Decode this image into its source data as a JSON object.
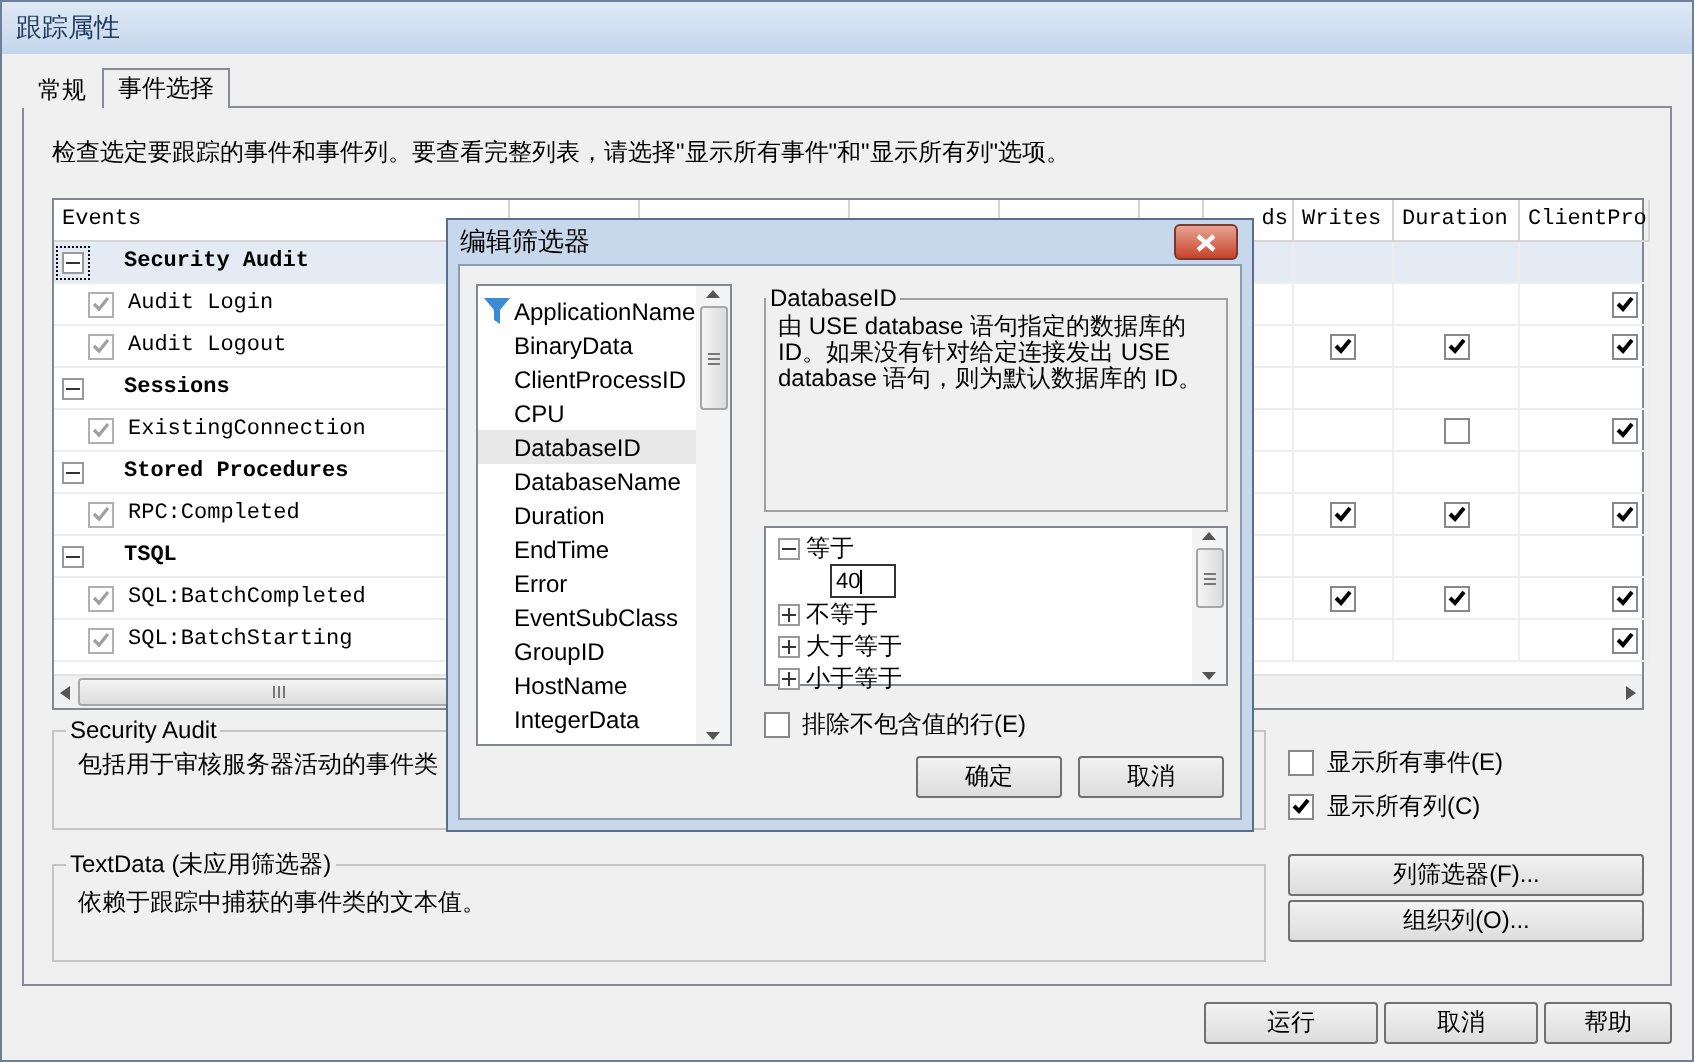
{
  "window": {
    "title": "跟踪属性"
  },
  "tabs": [
    {
      "label": "常规",
      "selected": false
    },
    {
      "label": "事件选择",
      "selected": true
    }
  ],
  "instructions": "检查选定要跟踪的事件和事件列。要查看完整列表，请选择\"显示所有事件\"和\"显示所有列\"选项。",
  "grid": {
    "columns": [
      {
        "label": "Events"
      },
      {
        "label": "ds"
      },
      {
        "label": "Writes"
      },
      {
        "label": "Duration"
      },
      {
        "label": "ClientPro"
      }
    ],
    "rows": [
      {
        "kind": "group",
        "label": "Security Audit",
        "expanded": true,
        "selected": true
      },
      {
        "kind": "event",
        "label": "Audit Login",
        "checked": true,
        "selected": false,
        "cells": [
          {
            "kind": "blank"
          },
          {
            "kind": "blank"
          },
          {
            "kind": "checkbox",
            "checked": true
          }
        ]
      },
      {
        "kind": "event",
        "label": "Audit Logout",
        "checked": true,
        "selected": false,
        "cells": [
          {
            "kind": "checkbox",
            "checked": true
          },
          {
            "kind": "checkbox",
            "checked": true
          },
          {
            "kind": "checkbox",
            "checked": true
          }
        ]
      },
      {
        "kind": "group",
        "label": "Sessions",
        "expanded": true,
        "selected": false
      },
      {
        "kind": "event",
        "label": "ExistingConnection",
        "checked": true,
        "selected": false,
        "cells": [
          {
            "kind": "blank"
          },
          {
            "kind": "checkbox",
            "checked": false
          },
          {
            "kind": "checkbox",
            "checked": true
          }
        ]
      },
      {
        "kind": "group",
        "label": "Stored Procedures",
        "expanded": true,
        "selected": false
      },
      {
        "kind": "event",
        "label": "RPC:Completed",
        "checked": true,
        "selected": false,
        "cells": [
          {
            "kind": "checkbox",
            "checked": true
          },
          {
            "kind": "checkbox",
            "checked": true
          },
          {
            "kind": "checkbox",
            "checked": true
          }
        ]
      },
      {
        "kind": "group",
        "label": "TSQL",
        "expanded": true,
        "selected": false
      },
      {
        "kind": "event",
        "label": "SQL:BatchCompleted",
        "checked": true,
        "selected": false,
        "cells": [
          {
            "kind": "checkbox",
            "checked": true
          },
          {
            "kind": "checkbox",
            "checked": true
          },
          {
            "kind": "checkbox",
            "checked": true
          }
        ]
      },
      {
        "kind": "event",
        "label": "SQL:BatchStarting",
        "checked": true,
        "selected": false,
        "cells": [
          {
            "kind": "blank"
          },
          {
            "kind": "blank"
          },
          {
            "kind": "checkbox",
            "checked": true
          }
        ]
      }
    ]
  },
  "event_info": {
    "title": "Security Audit",
    "text": "包括用于审核服务器活动的事件类"
  },
  "column_info": {
    "title": "TextData (未应用筛选器)",
    "text": "依赖于跟踪中捕获的事件类的文本值。"
  },
  "options": [
    {
      "label": "显示所有事件(E)",
      "checked": false
    },
    {
      "label": "显示所有列(C)",
      "checked": true
    }
  ],
  "side_buttons": [
    "列筛选器(F)...",
    "组织列(O)..."
  ],
  "buttons": [
    "运行",
    "取消",
    "帮助"
  ],
  "dialog": {
    "title": "编辑筛选器",
    "fields": [
      {
        "label": "ApplicationName",
        "filtered": true,
        "selected": false
      },
      {
        "label": "BinaryData",
        "filtered": false,
        "selected": false
      },
      {
        "label": "ClientProcessID",
        "filtered": false,
        "selected": false
      },
      {
        "label": "CPU",
        "filtered": false,
        "selected": false
      },
      {
        "label": "DatabaseID",
        "filtered": false,
        "selected": true
      },
      {
        "label": "DatabaseName",
        "filtered": false,
        "selected": false
      },
      {
        "label": "Duration",
        "filtered": false,
        "selected": false
      },
      {
        "label": "EndTime",
        "filtered": false,
        "selected": false
      },
      {
        "label": "Error",
        "filtered": false,
        "selected": false
      },
      {
        "label": "EventSubClass",
        "filtered": false,
        "selected": false
      },
      {
        "label": "GroupID",
        "filtered": false,
        "selected": false
      },
      {
        "label": "HostName",
        "filtered": false,
        "selected": false
      },
      {
        "label": "IntegerData",
        "filtered": false,
        "selected": false
      }
    ],
    "description": {
      "title": "DatabaseID",
      "text": "由 USE database 语句指定的数据库的 ID。如果没有针对给定连接发出 USE database 语句，则为默认数据库的 ID。"
    },
    "conditions": [
      {
        "label": "等于",
        "expanded": true,
        "value": "40"
      },
      {
        "label": "不等于",
        "expanded": false
      },
      {
        "label": "大于等于",
        "expanded": false
      },
      {
        "label": "小于等于",
        "expanded": false
      }
    ],
    "exclude": {
      "label": "排除不包含值的行(E)",
      "checked": false
    },
    "buttons": [
      "确定",
      "取消"
    ]
  }
}
